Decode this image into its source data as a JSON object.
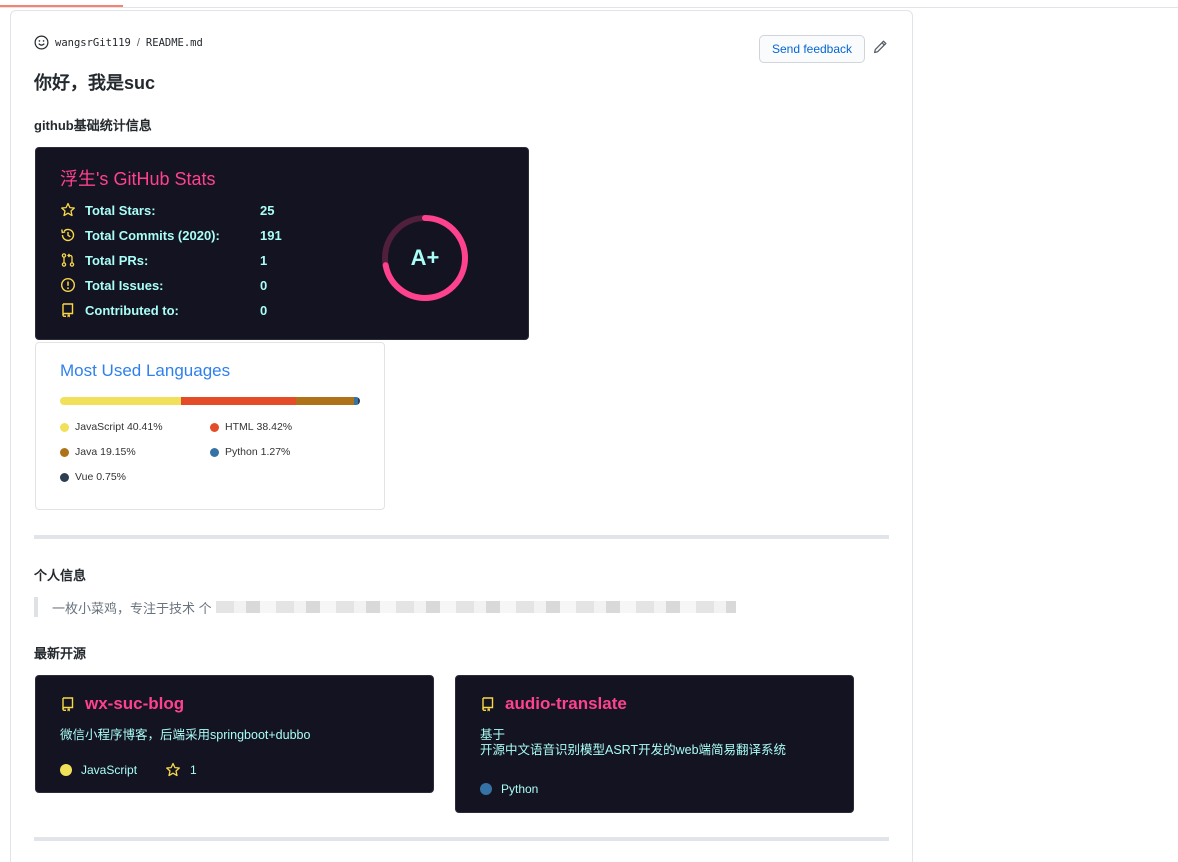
{
  "header": {
    "user": "wangsrGit119",
    "separator": "/",
    "file": "README.md",
    "feedback_label": "Send feedback"
  },
  "readme": {
    "title": "你好，我是suc",
    "section_stats": "github基础统计信息",
    "section_personal": "个人信息",
    "personal_quote": "一枚小菜鸡，专注于技术 个",
    "section_latest": "最新开源"
  },
  "stats_card": {
    "title_name": "浮生",
    "title_rest": "'s GitHub Stats",
    "rows": [
      {
        "icon": "star-icon",
        "label": "Total Stars:",
        "value": "25"
      },
      {
        "icon": "history-icon",
        "label": "Total Commits (2020):",
        "value": "191"
      },
      {
        "icon": "pull-request-icon",
        "label": "Total PRs:",
        "value": "1"
      },
      {
        "icon": "issue-icon",
        "label": "Total Issues:",
        "value": "0"
      },
      {
        "icon": "repo-icon",
        "label": "Contributed to:",
        "value": "0"
      }
    ],
    "rank": "A+",
    "rank_progress": 0.72
  },
  "languages_card": {
    "title": "Most Used Languages",
    "languages": [
      {
        "name": "JavaScript",
        "percent_label": "40.41%",
        "percent": 40.41,
        "color": "#f1e05a"
      },
      {
        "name": "HTML",
        "percent_label": "38.42%",
        "percent": 38.42,
        "color": "#e34c26"
      },
      {
        "name": "Java",
        "percent_label": "19.15%",
        "percent": 19.15,
        "color": "#b07219"
      },
      {
        "name": "Python",
        "percent_label": "1.27%",
        "percent": 1.27,
        "color": "#3572a5"
      },
      {
        "name": "Vue",
        "percent_label": "0.75%",
        "percent": 0.75,
        "color": "#2c3e50"
      }
    ]
  },
  "repos": [
    {
      "name": "wx-suc-blog",
      "description_lines": [
        "微信小程序博客，后端采用springboot+dubbo"
      ],
      "language": "JavaScript",
      "language_color": "#f1e05a",
      "stars": "1"
    },
    {
      "name": "audio-translate",
      "description_lines": [
        "基于",
        "开源中文语音识别模型ASRT开发的web端简易翻译系统"
      ],
      "language": "Python",
      "language_color": "#3572a5",
      "stars": ""
    }
  ],
  "colors": {
    "card_bg": "#141321",
    "title_pink": "#fe428e",
    "text_cyan": "#a9fef7",
    "icon_yellow": "#f8d847",
    "link_blue": "#0366d6"
  }
}
